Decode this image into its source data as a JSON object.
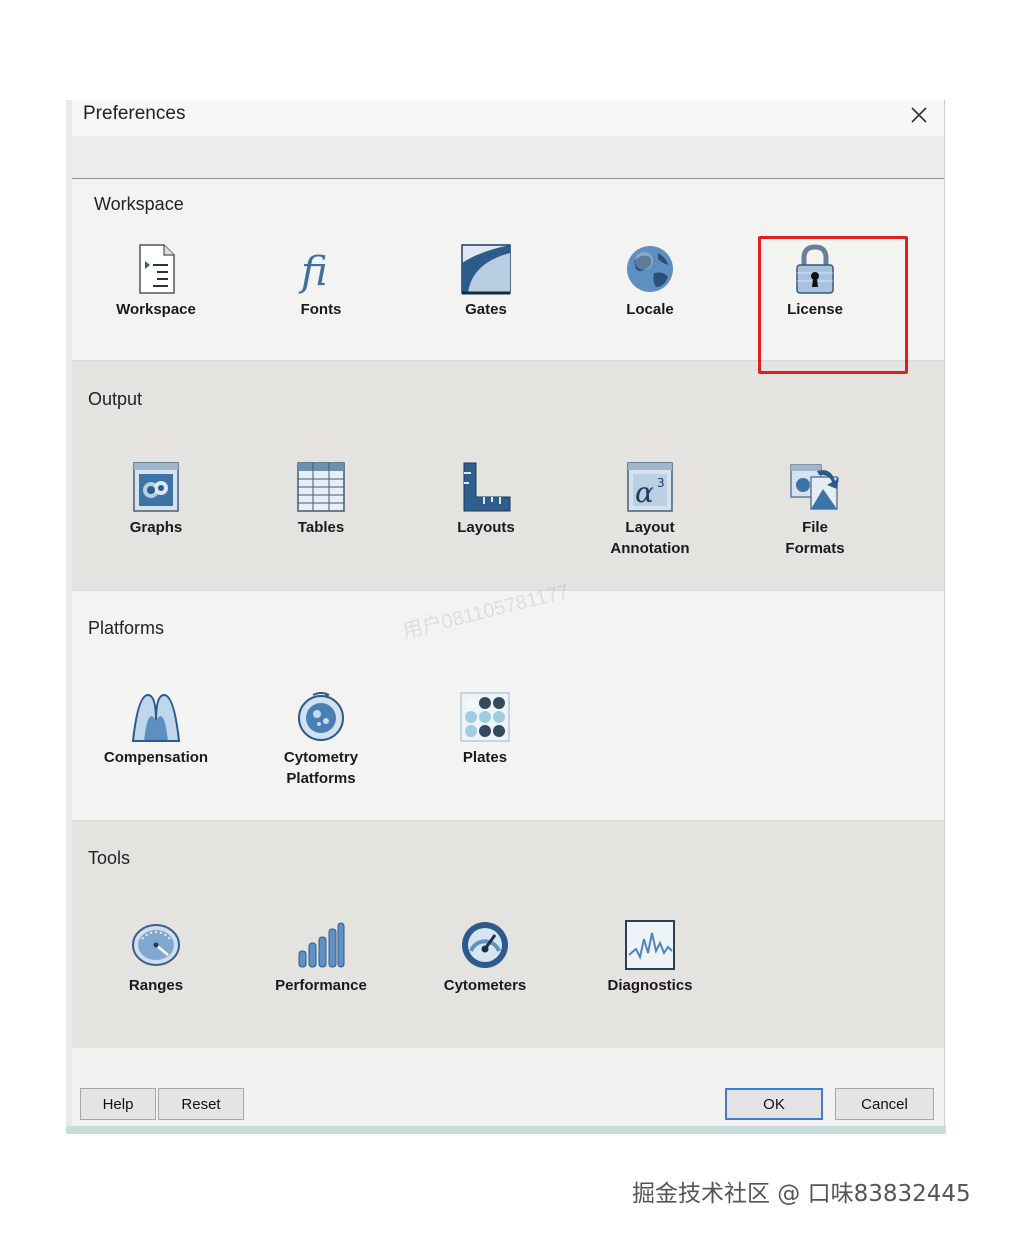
{
  "dialog": {
    "title": "Preferences"
  },
  "sections": {
    "workspace": {
      "title": "Workspace",
      "items": [
        {
          "label": "Workspace",
          "icon": "document-list-icon"
        },
        {
          "label": "Fonts",
          "icon": "fi-ligature-icon"
        },
        {
          "label": "Gates",
          "icon": "gate-curve-icon"
        },
        {
          "label": "Locale",
          "icon": "globe-icon"
        },
        {
          "label": "License",
          "icon": "padlock-icon"
        }
      ]
    },
    "output": {
      "title": "Output",
      "items": [
        {
          "label": "Graphs",
          "icon": "graph-window-icon"
        },
        {
          "label": "Tables",
          "icon": "table-grid-icon"
        },
        {
          "label": "Layouts",
          "icon": "ruler-l-icon"
        },
        {
          "label1": "Layout",
          "label2": "Annotation",
          "icon": "alpha-annotation-icon"
        },
        {
          "label1": "File",
          "label2": "Formats",
          "icon": "file-formats-icon"
        }
      ]
    },
    "platforms": {
      "title": "Platforms",
      "items": [
        {
          "label": "Compensation",
          "icon": "compensation-peaks-icon"
        },
        {
          "label1": "Cytometry",
          "label2": "Platforms",
          "icon": "cytometry-sphere-icon"
        },
        {
          "label": "Plates",
          "icon": "well-plate-icon"
        }
      ]
    },
    "tools": {
      "title": "Tools",
      "items": [
        {
          "label": "Ranges",
          "icon": "range-gauge-icon"
        },
        {
          "label": "Performance",
          "icon": "performance-bars-icon"
        },
        {
          "label": "Cytometers",
          "icon": "speedometer-icon"
        },
        {
          "label": "Diagnostics",
          "icon": "waveform-icon"
        }
      ]
    }
  },
  "buttons": {
    "help": "Help",
    "reset": "Reset",
    "ok": "OK",
    "cancel": "Cancel"
  },
  "overlay": {
    "faint_watermark": "用户081105781177",
    "footer_watermark": "掘金技术社区 @ 口味83832445"
  },
  "colors": {
    "highlight": "#e0201d",
    "ok_border": "#3c7fd1",
    "grey_section": "#e5e3df",
    "icon_blue": "#3f6f9a"
  }
}
